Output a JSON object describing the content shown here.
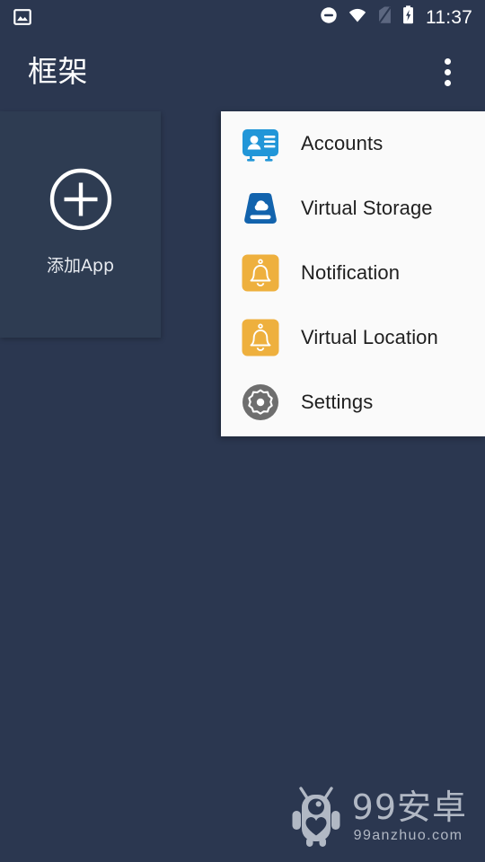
{
  "statusbar": {
    "left_icons": [
      {
        "name": "screenshot-image-icon",
        "glyph": "image"
      }
    ],
    "right_icons": [
      {
        "name": "do-not-disturb-icon",
        "glyph": "minus-circle"
      },
      {
        "name": "wifi-icon",
        "glyph": "wifi"
      },
      {
        "name": "no-sim-icon",
        "glyph": "sim-off"
      },
      {
        "name": "battery-charging-icon",
        "glyph": "battery-bolt"
      }
    ],
    "clock": "11:37"
  },
  "toolbar": {
    "title": "框架",
    "overflow_label": "更多选项"
  },
  "home": {
    "add_app": {
      "label": "添加App",
      "icon": "plus-circle-icon"
    }
  },
  "menu": {
    "items": [
      {
        "label": "Accounts",
        "icon": "accounts-icon",
        "icon_color": "#2196d8"
      },
      {
        "label": "Virtual Storage",
        "icon": "virtual-storage-icon",
        "icon_color": "#1263ad"
      },
      {
        "label": "Notification",
        "icon": "notification-bell-icon",
        "icon_color": "#eeb03e"
      },
      {
        "label": "Virtual Location",
        "icon": "virtual-location-icon",
        "icon_color": "#eeb03e"
      },
      {
        "label": "Settings",
        "icon": "settings-gear-icon",
        "icon_color": "#6e6e6e"
      }
    ]
  },
  "watermark": {
    "title": "99安卓",
    "subtitle": "99anzhuo.com",
    "mascot": "robot-mascot-icon"
  },
  "colors": {
    "background": "#2b3750",
    "card": "#2e3c52",
    "menu_background": "#fafafa",
    "menu_text": "#1f1f1f",
    "accent_blue": "#2196d8",
    "accent_amber": "#eeb03e",
    "watermark_gray": "#b9bfcb"
  }
}
